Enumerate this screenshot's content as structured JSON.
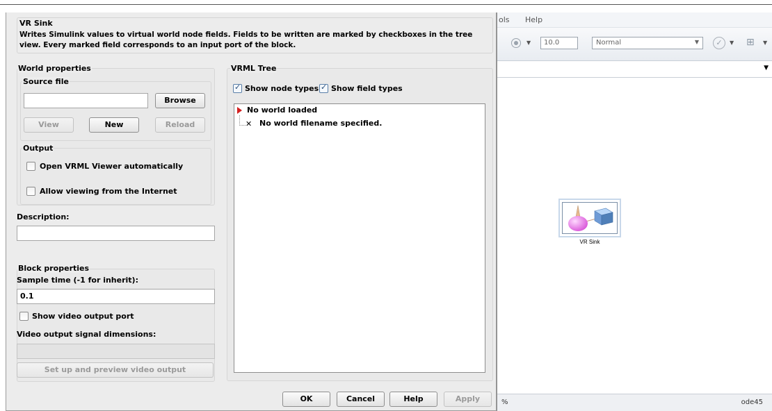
{
  "model_window": {
    "menu": {
      "tools_partial": "ols",
      "help": "Help"
    },
    "toolbar": {
      "stop_time": "10.0",
      "sim_mode": "Normal",
      "radio_icon": "record-icon",
      "check_icon": "checkmark-circle-icon",
      "grid_icon": "grid-icon"
    },
    "block": {
      "name": "VR Sink",
      "icon": "vr-scene-icon"
    },
    "status": {
      "zoom_partial": "%",
      "solver": "ode45"
    }
  },
  "dialog": {
    "title": "VR Sink",
    "description": "Writes Simulink values to virtual world node fields. Fields to be written are marked by checkboxes in the tree view. Every marked field corresponds to an input port of the block.",
    "world_properties": {
      "group_label": "World properties",
      "source_file": {
        "group_label": "Source file",
        "value": "",
        "browse": "Browse",
        "view": "View",
        "new": "New",
        "reload": "Reload"
      },
      "output": {
        "group_label": "Output",
        "open_viewer": {
          "label": "Open VRML Viewer automatically",
          "checked": false
        },
        "allow_internet": {
          "label": "Allow viewing from the Internet",
          "checked": false
        }
      },
      "description_label": "Description:",
      "description_value": ""
    },
    "block_properties": {
      "group_label": "Block properties",
      "sample_time_label": "Sample time (-1 for inherit):",
      "sample_time_value": "0.1",
      "show_video_port": {
        "label": "Show video output port",
        "checked": false
      },
      "video_dims_label": "Video output signal dimensions:",
      "video_dims_value": "",
      "setup_preview": "Set up and preview video output"
    },
    "vrml_tree": {
      "group_label": "VRML Tree",
      "show_node_types": {
        "label": "Show node types",
        "checked": true
      },
      "show_field_types": {
        "label": "Show field types",
        "checked": true
      },
      "root": "No world loaded",
      "child": "No world filename specified."
    },
    "buttons": {
      "ok": "OK",
      "cancel": "Cancel",
      "help": "Help",
      "apply": "Apply"
    }
  }
}
